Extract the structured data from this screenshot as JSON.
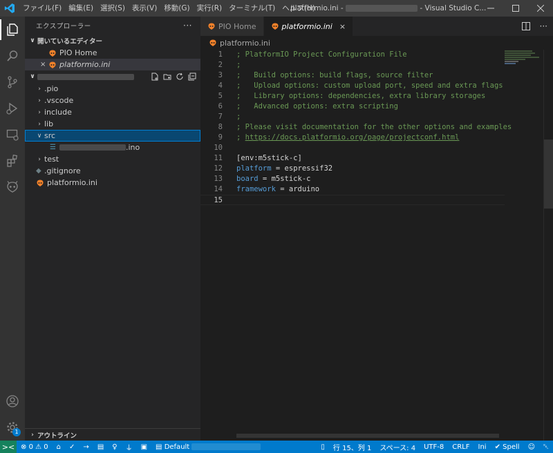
{
  "titlebar": {
    "menus": [
      "ファイル(F)",
      "編集(E)",
      "選択(S)",
      "表示(V)",
      "移動(G)",
      "実行(R)",
      "ターミナル(T)",
      "ヘルプ(H)"
    ],
    "title_prefix": "platformio.ini - ",
    "title_suffix": " - Visual Studio C..."
  },
  "sidebar": {
    "header": "エクスプローラー",
    "more": "···",
    "open_editors_title": "開いているエディター",
    "open_editors": [
      "PIO Home",
      "platformio.ini"
    ],
    "tree": [
      ".pio",
      ".vscode",
      "include",
      "lib",
      "src",
      ".ino",
      "test",
      ".gitignore",
      "platformio.ini"
    ],
    "outline_title": "アウトライン"
  },
  "tabs": [
    {
      "label": "PIO Home"
    },
    {
      "label": "platformio.ini",
      "close": "×"
    }
  ],
  "breadcrumb": "platformio.ini",
  "code_lines": [
    {
      "n": "1",
      "cls": "c-comment",
      "text": "; PlatformIO Project Configuration File"
    },
    {
      "n": "2",
      "cls": "c-comment",
      "text": ";"
    },
    {
      "n": "3",
      "cls": "c-comment",
      "text": ";   Build options: build flags, source filter"
    },
    {
      "n": "4",
      "cls": "c-comment",
      "text": ";   Upload options: custom upload port, speed and extra flags"
    },
    {
      "n": "5",
      "cls": "c-comment",
      "text": ";   Library options: dependencies, extra library storages"
    },
    {
      "n": "6",
      "cls": "c-comment",
      "text": ";   Advanced options: extra scripting"
    },
    {
      "n": "7",
      "cls": "c-comment",
      "text": ";"
    },
    {
      "n": "8",
      "cls": "c-comment",
      "text": "; Please visit documentation for the other options and examples"
    },
    {
      "n": "9",
      "cls": "c-comment",
      "text": "; ",
      "link": "https://docs.platformio.org/page/projectconf.html"
    },
    {
      "n": "10",
      "cls": "c-plain",
      "text": ""
    },
    {
      "n": "11",
      "cls": "c-plain",
      "text": "[env:m5stick-c]"
    },
    {
      "n": "12",
      "cls": "kv",
      "key": "platform",
      "eq": " = ",
      "val": "espressif32"
    },
    {
      "n": "13",
      "cls": "kv",
      "key": "board",
      "eq": " = ",
      "val": "m5stick-c"
    },
    {
      "n": "14",
      "cls": "kv",
      "key": "framework",
      "eq": " = ",
      "val": "arduino"
    },
    {
      "n": "15",
      "cls": "c-plain",
      "text": ""
    }
  ],
  "statusbar": {
    "remote": "><",
    "errors": "0",
    "warnings": "0",
    "env_label": "Default",
    "position": "行 15、列 1",
    "spaces": "スペース: 4",
    "encoding": "UTF-8",
    "eol": "CRLF",
    "language": "Ini",
    "spell": "Spell",
    "bell_badge": "1"
  },
  "colors": {
    "accent": "#007acc",
    "selection": "#094771",
    "comment": "#6a9955",
    "keyword": "#569cd6",
    "pio_orange": "#f5822a"
  }
}
